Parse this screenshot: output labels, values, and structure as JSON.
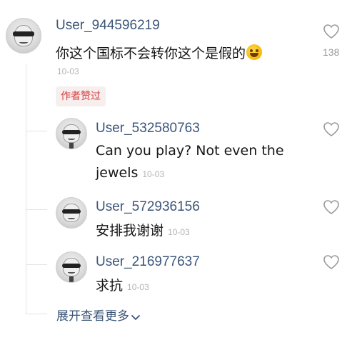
{
  "comment": {
    "username": "User_944596219",
    "text": "你这个国标不会转你这个是假的",
    "emoji_icon": "grinning-emoji",
    "timestamp": "10-03",
    "like_count": "138",
    "author_badge": "作者赞过"
  },
  "replies": [
    {
      "username": "User_532580763",
      "text_line1": "Can you play? Not even the",
      "text_line2": "jewels",
      "timestamp": "10-03"
    },
    {
      "username": "User_572936156",
      "text": "安排我谢谢",
      "timestamp": "10-03"
    },
    {
      "username": "User_216977637",
      "text": "求抗",
      "timestamp": "10-03"
    }
  ],
  "expand_label": "展开查看更多",
  "colors": {
    "username": "#3b5578",
    "badge_text": "#d7403f",
    "badge_bg": "#f7eeee",
    "muted": "#b3b3b3"
  }
}
